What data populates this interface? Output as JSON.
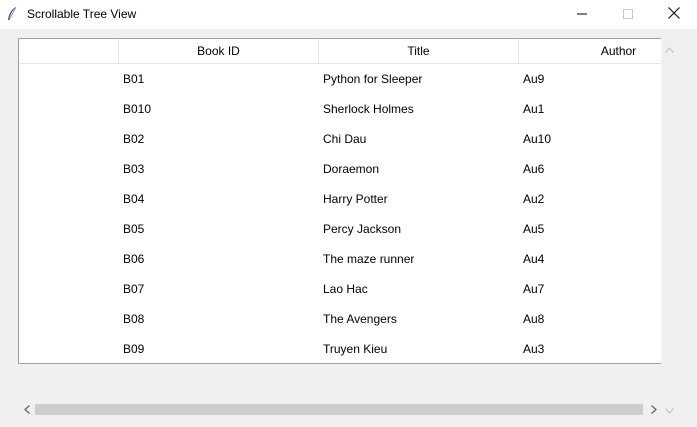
{
  "window": {
    "title": "Scrollable Tree View"
  },
  "tree": {
    "columns": [
      "",
      "Book ID",
      "Title",
      "Author"
    ],
    "rows": [
      {
        "book_id": "B01",
        "title": "Python for Sleeper",
        "author": "Au9"
      },
      {
        "book_id": "B010",
        "title": "Sherlock Holmes",
        "author": "Au1"
      },
      {
        "book_id": "B02",
        "title": "Chi Dau",
        "author": "Au10"
      },
      {
        "book_id": "B03",
        "title": "Doraemon",
        "author": "Au6"
      },
      {
        "book_id": "B04",
        "title": "Harry Potter",
        "author": "Au2"
      },
      {
        "book_id": "B05",
        "title": "Percy Jackson",
        "author": "Au5"
      },
      {
        "book_id": "B06",
        "title": "The maze runner",
        "author": "Au4"
      },
      {
        "book_id": "B07",
        "title": "Lao Hac",
        "author": "Au7"
      },
      {
        "book_id": "B08",
        "title": "The Avengers",
        "author": "Au8"
      },
      {
        "book_id": "B09",
        "title": "Truyen Kieu",
        "author": "Au3"
      }
    ]
  },
  "icons": {
    "app": "feather-icon",
    "minimize": "minimize-icon",
    "maximize": "maximize-icon",
    "close": "close-icon",
    "scroll_up": "chevron-up-icon",
    "scroll_down": "chevron-down-icon",
    "scroll_left": "chevron-left-icon",
    "scroll_right": "chevron-right-icon"
  },
  "colors": {
    "titlebar": "#ffffff",
    "window_bg": "#f0f0f0",
    "tree_bg": "#ffffff",
    "scroll_thumb": "#cdcdcd"
  }
}
